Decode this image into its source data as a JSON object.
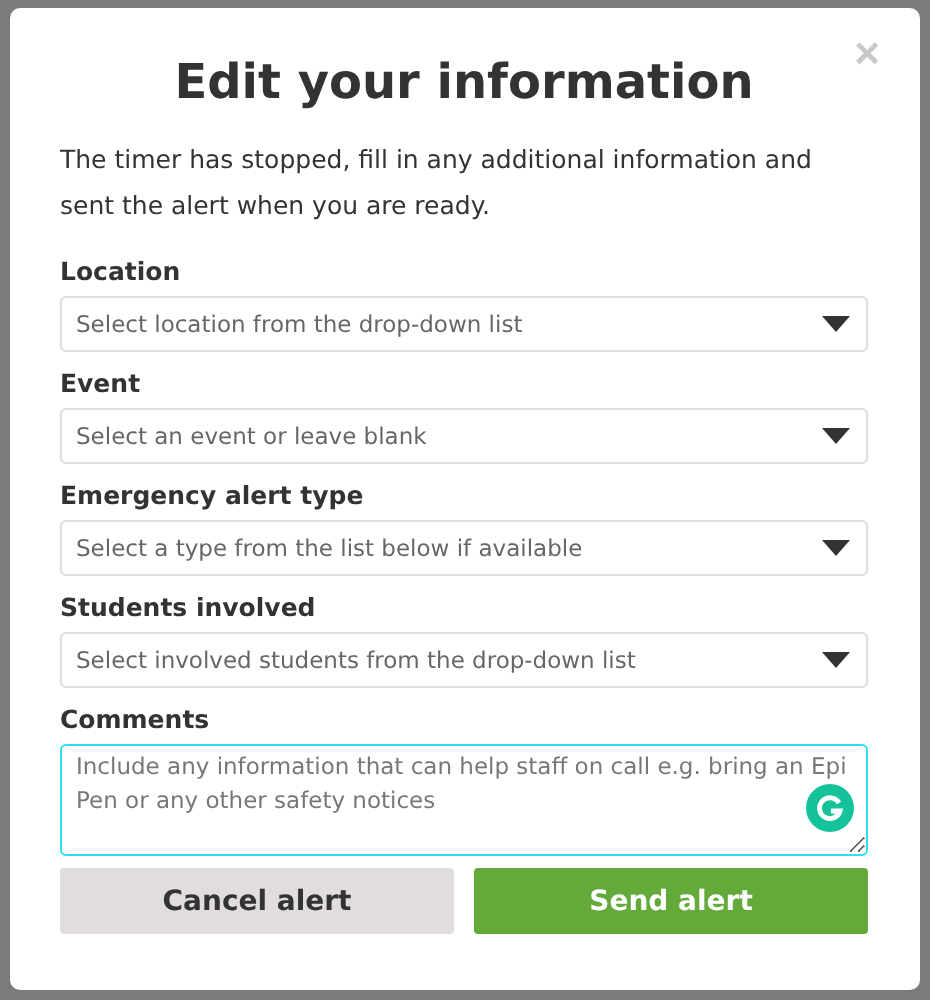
{
  "dialog": {
    "title": "Edit your information",
    "close": "×",
    "description": "The timer has stopped, fill in any additional information and sent the alert when you are ready.",
    "fields": [
      {
        "kind": "select",
        "label": "Location",
        "placeholder": "Select location from the drop-down list"
      },
      {
        "kind": "select",
        "label": "Event",
        "placeholder": "Select an event or leave blank"
      },
      {
        "kind": "select",
        "label": "Emergency alert type",
        "placeholder": "Select a type from the list below if available"
      },
      {
        "kind": "select",
        "label": "Students involved",
        "placeholder": "Select involved students from the drop-down list"
      },
      {
        "kind": "textarea",
        "label": "Comments",
        "placeholder": "Include any information that can help staff on call e.g. bring an Epi Pen or any other safety notices"
      }
    ],
    "buttons": [
      {
        "kind": "secondary",
        "label": "Cancel alert"
      },
      {
        "kind": "primary",
        "label": "Send alert"
      }
    ]
  }
}
